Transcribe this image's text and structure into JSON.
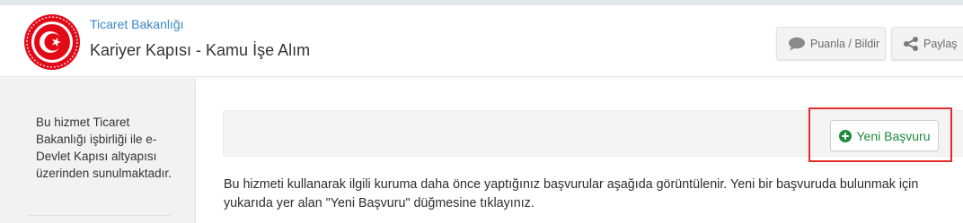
{
  "header": {
    "org_name": "Ticaret Bakanlığı",
    "service_title": "Kariyer Kapısı - Kamu İşe Alım",
    "rate_button": "Puanla / Bildir",
    "share_button": "Paylaş"
  },
  "sidebar": {
    "info_text": "Bu hizmet Ticaret Bakanlığı işbirliği ile e-Devlet Kapısı altyapısı üzerinden sunulmaktadır."
  },
  "main": {
    "new_application_button": "Yeni Başvuru",
    "description": "Bu hizmeti kullanarak ilgili kuruma daha önce yaptığınız başvurular aşağıda görüntülenir. Yeni bir başvuruda bulunmak için yukarıda yer alan \"Yeni Başvuru\" düğmesine tıklayınız."
  },
  "colors": {
    "brand_red": "#e30a17",
    "link_blue": "#3a86c8",
    "action_green": "#1e8a3c",
    "highlight_red": "#e22b2b"
  },
  "icons": {
    "logo": "ticaret-bakanligi-logo",
    "rate": "speech-bubble-icon",
    "share": "share-icon",
    "new": "plus-circle-icon"
  }
}
